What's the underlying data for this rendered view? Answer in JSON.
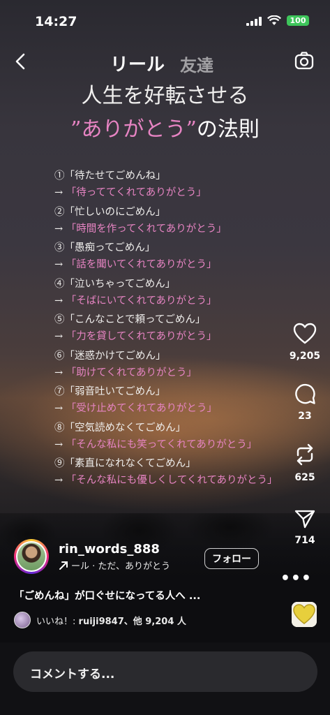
{
  "status": {
    "time": "14:27",
    "battery": "100"
  },
  "nav": {
    "title": "リール",
    "friends": "友達"
  },
  "headline": {
    "line1": "人生を好転させる",
    "line2_pink": "”ありがとう”",
    "line2_rest": "の法則"
  },
  "items": [
    {
      "n": "①",
      "a": "「待たせてごめんね」",
      "b": "「待っててくれてありがとう」"
    },
    {
      "n": "②",
      "a": "「忙しいのにごめん」",
      "b": "「時間を作ってくれてありがとう」"
    },
    {
      "n": "③",
      "a": "「愚痴ってごめん」",
      "b": "「話を聞いてくれてありがとう」"
    },
    {
      "n": "④",
      "a": "「泣いちゃってごめん」",
      "b": "「そばにいてくれてありがとう」"
    },
    {
      "n": "⑤",
      "a": "「こんなことで頼ってごめん」",
      "b": "「力を貸してくれてありがとう」"
    },
    {
      "n": "⑥",
      "a": "「迷惑かけてごめん」",
      "b": "「助けてくれてありがとう」"
    },
    {
      "n": "⑦",
      "a": "「弱音吐いてごめん」",
      "b": "「受け止めてくれてありがとう」"
    },
    {
      "n": "⑧",
      "a": "「空気読めなくてごめん」",
      "b": "「そんな私にも笑ってくれてありがとう」"
    },
    {
      "n": "⑨",
      "a": "「素直になれなくてごめん」",
      "b": "「そんな私にも優しくしてくれてありがとう」"
    }
  ],
  "arrow": "→",
  "actions": {
    "likes": "9,205",
    "comments": "23",
    "reposts": "625",
    "shares": "714",
    "more": "•••"
  },
  "user": {
    "name": "rin_words_888",
    "sub": "ール · ただ、ありがとう",
    "follow": "フォロー"
  },
  "caption": "「ごめんね」が口ぐせになってる人へ ...",
  "liked": {
    "prefix": "いいね！:",
    "rest": "ruiji9847、他 9,204 人"
  },
  "comment_placeholder": "コメントする..."
}
